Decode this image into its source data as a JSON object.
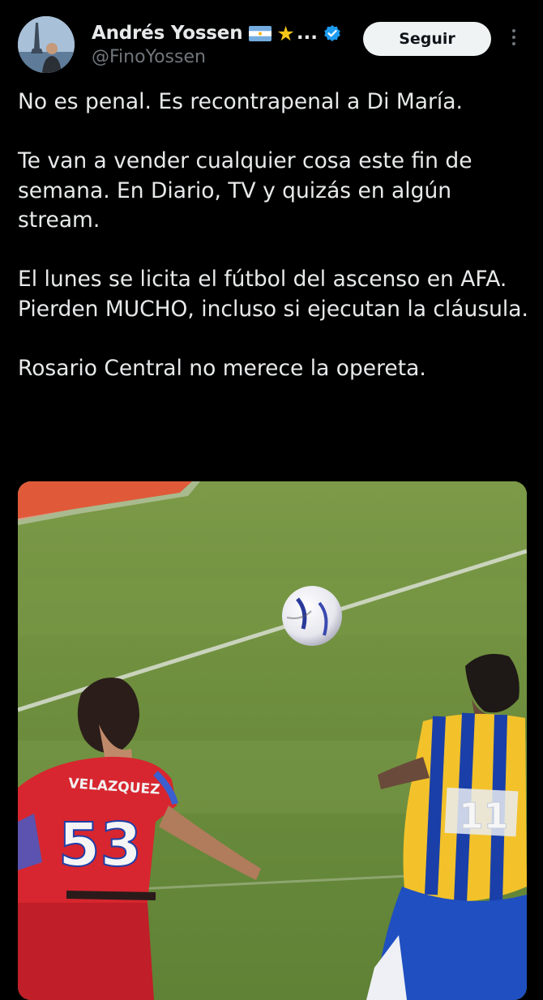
{
  "author": {
    "display_name": "Andrés Yossen",
    "name_suffix": "...",
    "handle": "@FinoYossen",
    "avatar_icon": "avatar-photo",
    "flag_icon": "argentina-flag-icon",
    "star_icon": "star-emoji-icon",
    "verified_icon": "verified-badge-icon",
    "verified_color": "#1d9bf0"
  },
  "actions": {
    "follow_label": "Seguir",
    "more_icon": "more-options-icon"
  },
  "tweet": {
    "paragraphs": [
      "No es penal. Es recontrapenal a Di María.",
      "Te van a vender cualquier cosa este fin de semana. En Diario, TV y quizás en algún stream.",
      "El lunes se licita el fútbol del ascenso en AFA. Pierden MUCHO, incluso si ejecutan la cláusula.",
      "Rosario Central no merece la opereta."
    ]
  },
  "media": {
    "left_player_name": "VELAZQUEZ",
    "left_player_number": "53",
    "right_player_number": "11",
    "pitch_color": "#6e8f3e"
  }
}
